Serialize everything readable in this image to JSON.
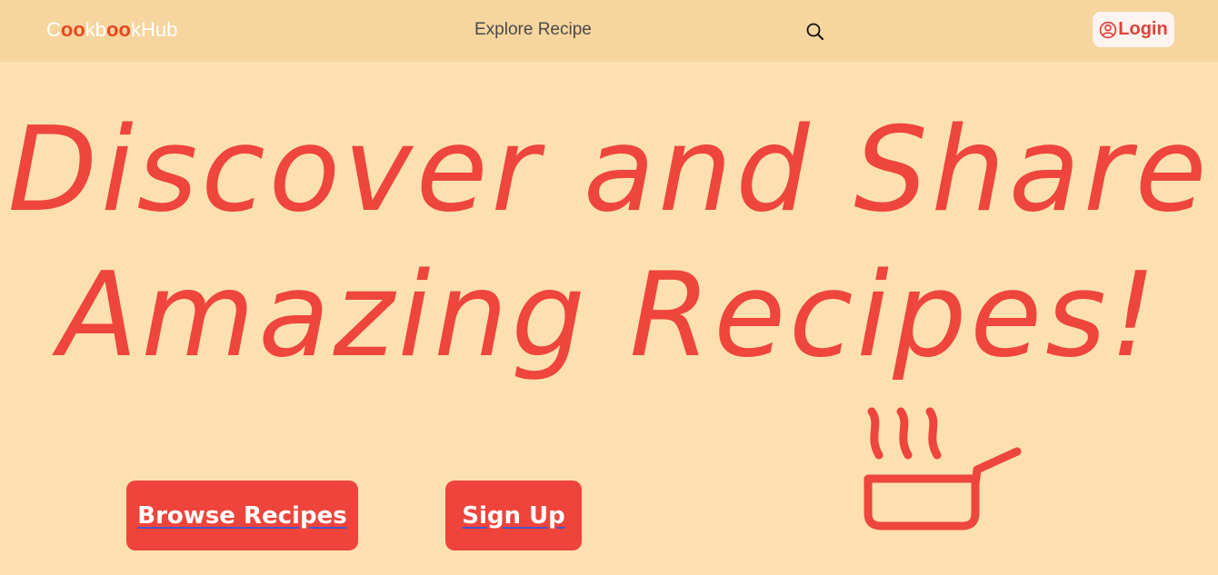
{
  "header": {
    "logo": {
      "parts": [
        "C",
        "o",
        "o",
        "kb",
        "o",
        "o",
        "kHub"
      ]
    },
    "nav_link": "Explore Recipe",
    "login_label": "Login",
    "icons": {
      "search": "search-icon",
      "user": "user-circle-icon"
    }
  },
  "hero": {
    "title_line1": "Discover and Share",
    "title_line2": "Amazing Recipes!"
  },
  "actions": {
    "browse_label": "Browse Recipes",
    "signup_label": "Sign Up"
  },
  "illustration": {
    "icon": "steaming-pan-icon"
  },
  "colors": {
    "background": "#fde0b0",
    "navbar": "#f6d59e",
    "accent": "#ee453c",
    "logo_o": "#e8471d",
    "login_bg": "#fdf3ef"
  }
}
